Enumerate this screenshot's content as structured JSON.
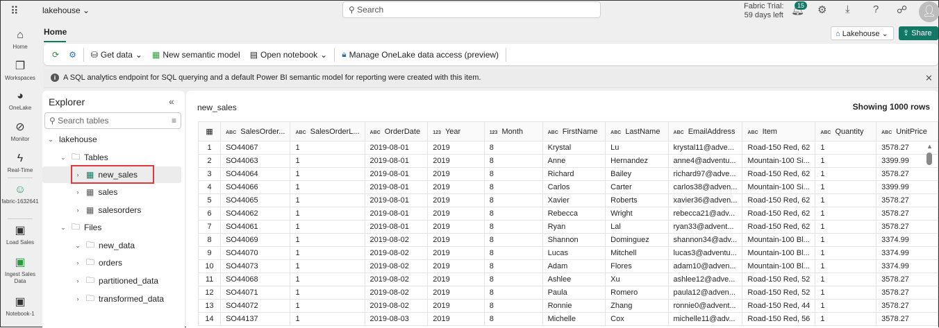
{
  "topbar": {
    "workspace": "lakehouse",
    "search_placeholder": "Search",
    "trial_line1": "Fabric Trial:",
    "trial_line2": "59 days left",
    "notifications": "15"
  },
  "rail": [
    {
      "label": "Home"
    },
    {
      "label": "Workspaces"
    },
    {
      "label": "OneLake"
    },
    {
      "label": "Monitor"
    },
    {
      "label": "Real-Time"
    },
    {
      "label": "fabric-1632641"
    },
    {
      "label": "Load Sales"
    },
    {
      "label": "Ingest Sales Data"
    },
    {
      "label": "Notebook-1"
    }
  ],
  "tabs": {
    "home": "Home"
  },
  "ribbon": {
    "get_data": "Get data",
    "new_semantic_model": "New semantic model",
    "open_notebook": "Open notebook",
    "manage_access": "Manage OneLake data access (preview)"
  },
  "header_buttons": {
    "lakehouse": "Lakehouse",
    "share": "Share"
  },
  "info_bar": {
    "message": "A SQL analytics endpoint for SQL querying and a default Power BI semantic model for reporting were created with this item."
  },
  "explorer": {
    "title": "Explorer",
    "search_placeholder": "Search tables",
    "root": "lakehouse",
    "tables_label": "Tables",
    "tables": [
      "new_sales",
      "sales",
      "salesorders"
    ],
    "files_label": "Files",
    "files": [
      "new_data",
      "orders",
      "partitioned_data",
      "transformed_data"
    ]
  },
  "grid": {
    "table_name": "new_sales",
    "row_count": "Showing 1000 rows",
    "columns": [
      {
        "type": "ABC",
        "name": "SalesOrder..."
      },
      {
        "type": "ABC",
        "name": "SalesOrderL..."
      },
      {
        "type": "ABC",
        "name": "OrderDate"
      },
      {
        "type": "123",
        "name": "Year"
      },
      {
        "type": "123",
        "name": "Month"
      },
      {
        "type": "ABC",
        "name": "FirstName"
      },
      {
        "type": "ABC",
        "name": "LastName"
      },
      {
        "type": "ABC",
        "name": "EmailAddress"
      },
      {
        "type": "ABC",
        "name": "Item"
      },
      {
        "type": "ABC",
        "name": "Quantity"
      },
      {
        "type": "ABC",
        "name": "UnitPrice"
      }
    ],
    "rows": [
      [
        "1",
        "SO44067",
        "1",
        "2019-08-01",
        "2019",
        "8",
        "Krystal",
        "Lu",
        "krystal11@adve...",
        "Road-150 Red, 62",
        "1",
        "3578.27"
      ],
      [
        "2",
        "SO44063",
        "1",
        "2019-08-01",
        "2019",
        "8",
        "Anne",
        "Hernandez",
        "anne4@adventu...",
        "Mountain-100 Si...",
        "1",
        "3399.99"
      ],
      [
        "3",
        "SO44064",
        "1",
        "2019-08-01",
        "2019",
        "8",
        "Richard",
        "Bailey",
        "richard97@adve...",
        "Road-150 Red, 62",
        "1",
        "3578.27"
      ],
      [
        "4",
        "SO44066",
        "1",
        "2019-08-01",
        "2019",
        "8",
        "Carlos",
        "Carter",
        "carlos38@adven...",
        "Mountain-100 Si...",
        "1",
        "3399.99"
      ],
      [
        "5",
        "SO44065",
        "1",
        "2019-08-01",
        "2019",
        "8",
        "Xavier",
        "Roberts",
        "xavier36@adven...",
        "Road-150 Red, 62",
        "1",
        "3578.27"
      ],
      [
        "6",
        "SO44062",
        "1",
        "2019-08-01",
        "2019",
        "8",
        "Rebecca",
        "Wright",
        "rebecca21@adv...",
        "Road-150 Red, 62",
        "1",
        "3578.27"
      ],
      [
        "7",
        "SO44061",
        "1",
        "2019-08-01",
        "2019",
        "8",
        "Ryan",
        "Lal",
        "ryan33@advent...",
        "Road-150 Red, 62",
        "1",
        "3578.27"
      ],
      [
        "8",
        "SO44069",
        "1",
        "2019-08-02",
        "2019",
        "8",
        "Shannon",
        "Dominguez",
        "shannon34@adv...",
        "Mountain-100 Bl...",
        "1",
        "3374.99"
      ],
      [
        "9",
        "SO44070",
        "1",
        "2019-08-02",
        "2019",
        "8",
        "Lucas",
        "Mitchell",
        "lucas3@adventu...",
        "Mountain-100 Bl...",
        "1",
        "3374.99"
      ],
      [
        "10",
        "SO44073",
        "1",
        "2019-08-02",
        "2019",
        "8",
        "Adam",
        "Flores",
        "adam10@adven...",
        "Mountain-100 Bl...",
        "1",
        "3374.99"
      ],
      [
        "11",
        "SO44068",
        "1",
        "2019-08-02",
        "2019",
        "8",
        "Ashlee",
        "Xu",
        "ashlee12@adve...",
        "Road-150 Red, 52",
        "1",
        "3578.27"
      ],
      [
        "12",
        "SO44071",
        "1",
        "2019-08-02",
        "2019",
        "8",
        "Paula",
        "Romero",
        "paula12@adven...",
        "Road-150 Red, 52",
        "1",
        "3578.27"
      ],
      [
        "13",
        "SO44072",
        "1",
        "2019-08-02",
        "2019",
        "8",
        "Ronnie",
        "Zhang",
        "ronnie0@advent...",
        "Road-150 Red, 44",
        "1",
        "3578.27"
      ],
      [
        "14",
        "SO44137",
        "1",
        "2019-08-03",
        "2019",
        "8",
        "Michelle",
        "Cox",
        "michelle11@adv...",
        "Road-150 Red, 56",
        "1",
        "3578.27"
      ]
    ]
  },
  "colors": {
    "accent": "#117865",
    "highlight": "#e0383d"
  }
}
